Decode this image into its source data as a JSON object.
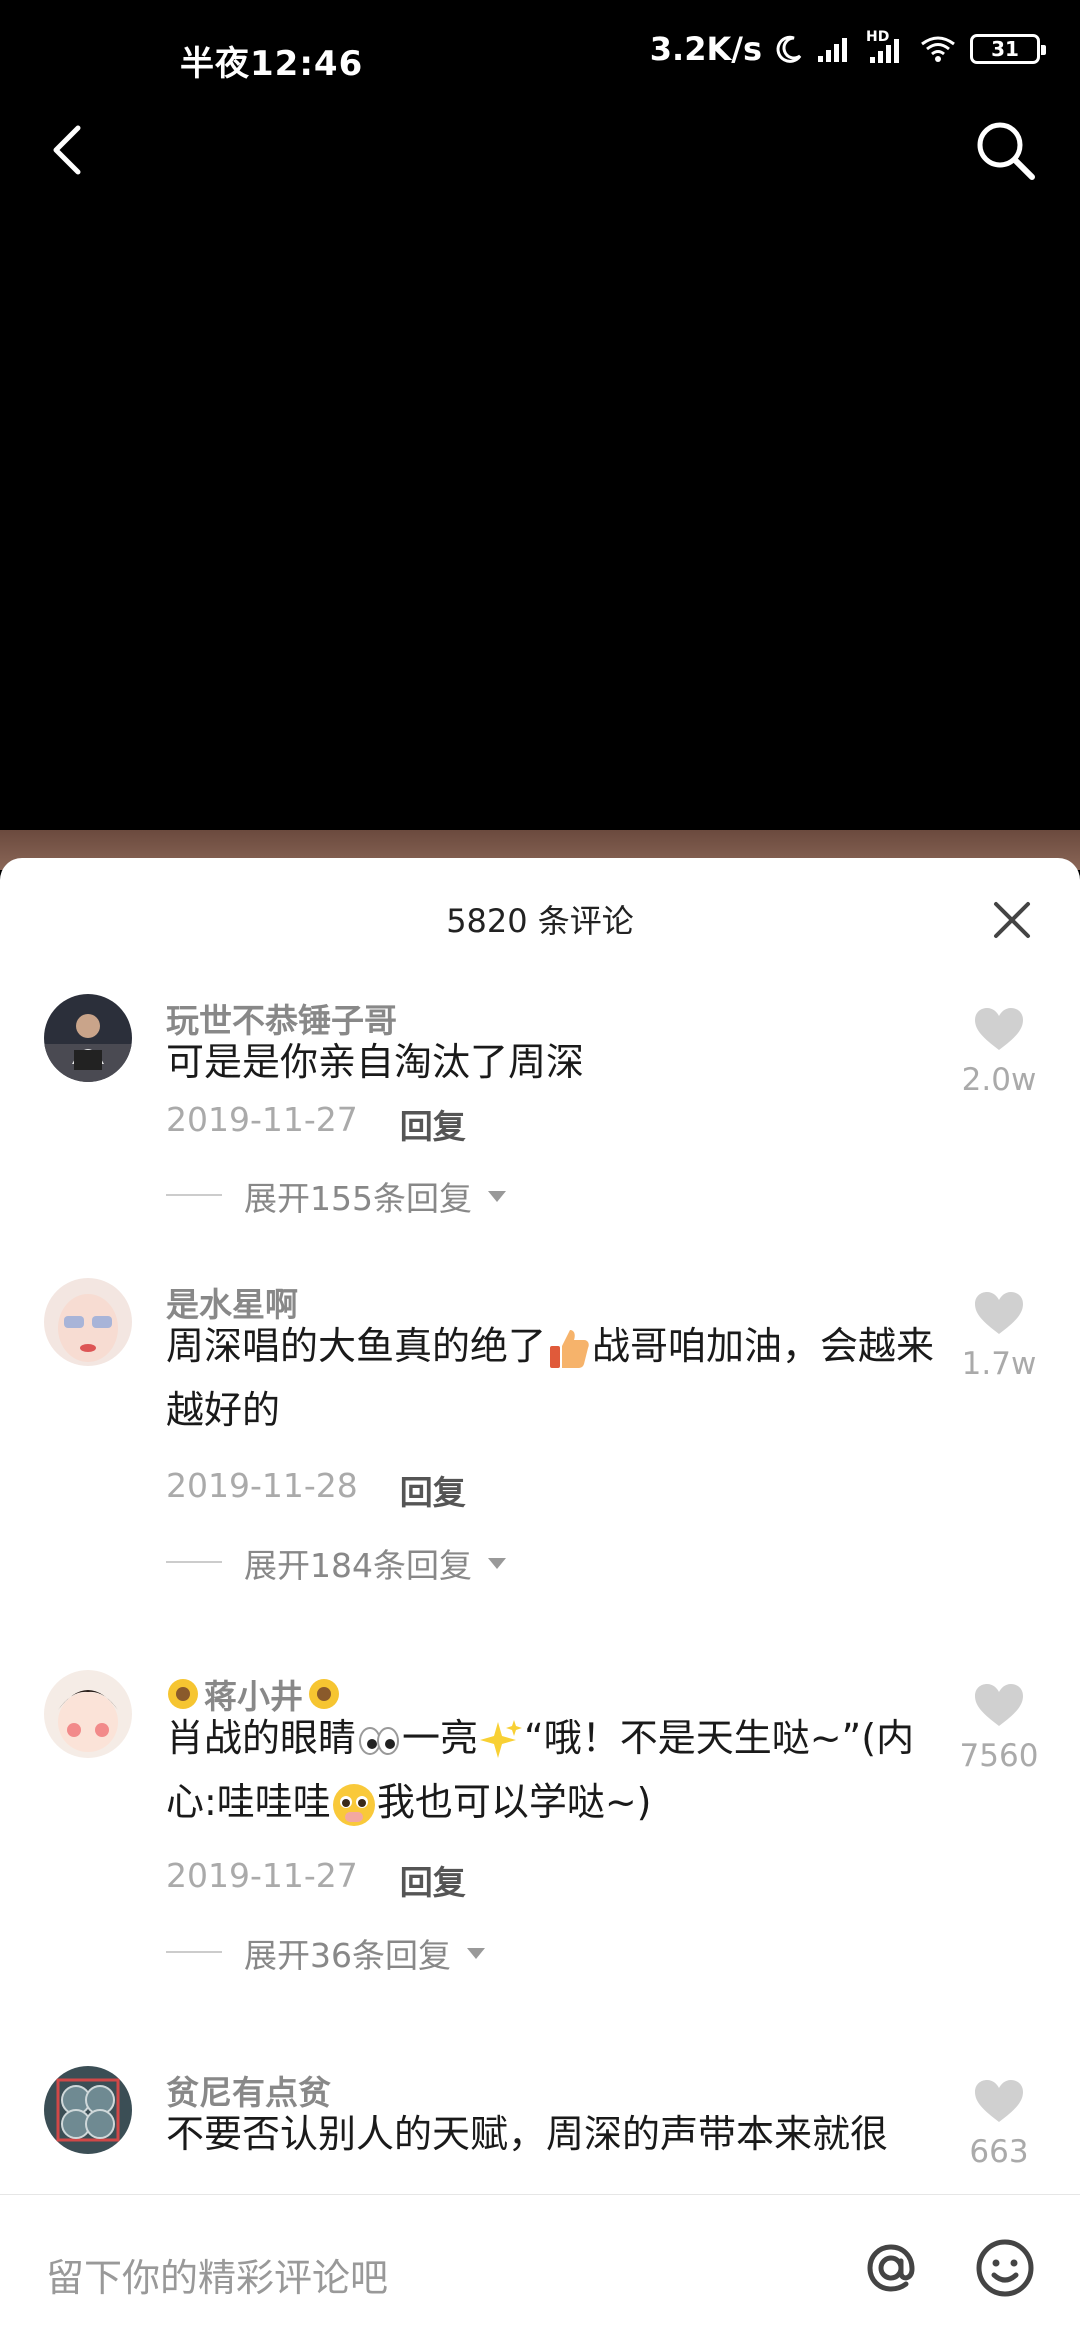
{
  "status_bar": {
    "time": "半夜12:46",
    "speed": "3.2K/s",
    "battery": "31",
    "network_label": "HD"
  },
  "header": {
    "back_icon": "chevron-left-icon",
    "search_icon": "search-icon"
  },
  "sheet": {
    "title": "5820 条评论",
    "close_icon": "close-icon"
  },
  "comments": [
    {
      "name": "玩世不恭锤子哥",
      "text": "可是是你亲自淘汰了周深",
      "date": "2019-11-27",
      "reply": "回复",
      "expand": "展开155条回复",
      "likes": "2.0w"
    },
    {
      "name": "是水星啊",
      "text_a": "周深唱的大鱼真的绝了",
      "text_b": "战哥咱加油，会越来越好的",
      "date": "2019-11-28",
      "reply": "回复",
      "expand": "展开184条回复",
      "likes": "1.7w"
    },
    {
      "name": "蒋小井",
      "text_a": "肖战的眼睛",
      "text_b": "一亮",
      "text_c": "“哦！不是天生哒~”(内心:哇哇哇",
      "text_d": "我也可以学哒~)",
      "date": "2019-11-27",
      "reply": "回复",
      "expand": "展开36条回复",
      "likes": "7560"
    },
    {
      "name": "贫尼有点贫",
      "text": "不要否认别人的天赋，周深的声带本来就很",
      "likes": "663"
    }
  ],
  "input_bar": {
    "placeholder": "留下你的精彩评论吧",
    "at_icon": "at-icon",
    "emoji_icon": "smiley-icon"
  },
  "colors": {
    "like_heart": "#d0d0d0",
    "sheet_bg": "#ffffff",
    "video_bg": "#000000"
  }
}
